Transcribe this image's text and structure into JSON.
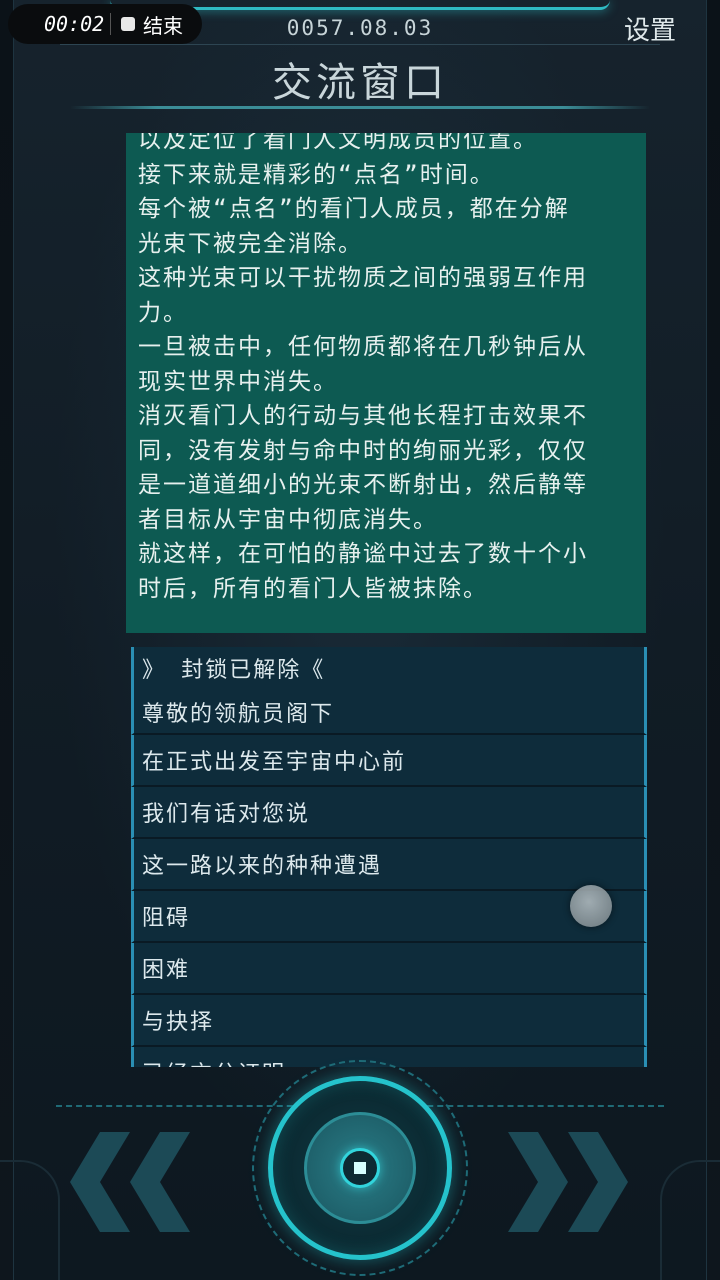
{
  "status_bar": {
    "record_time": "00:02",
    "record_end_label": "结束"
  },
  "header": {
    "date": "0057.08.03",
    "settings_label": "设置",
    "title": "交流窗口"
  },
  "story": {
    "lines": [
      "以及定位了看门人文明成员的位置。",
      "接下来就是精彩的“点名”时间。",
      "每个被“点名”的看门人成员，都在分解",
      "光束下被完全消除。",
      "这种光束可以干扰物质之间的强弱互作用",
      "力。",
      "一旦被击中，任何物质都将在几秒钟后从",
      "现实世界中消失。",
      "消灭看门人的行动与其他长程打击效果不",
      "同，没有发射与命中时的绚丽光彩，仅仅",
      "是一道道细小的光束不断射出，然后静等",
      "者目标从宇宙中彻底消失。",
      "就这样，在可怕的静谧中过去了数十个小",
      "时后，所有的看门人皆被抹除。"
    ]
  },
  "dialog": {
    "first": {
      "line1": "》 封锁已解除《",
      "line2": "尊敬的领航员阁下"
    },
    "items": [
      "在正式出发至宇宙中心前",
      "我们有话对您说",
      "这一路以来的种种遭遇",
      "阻碍",
      "困难",
      "与抉择",
      "已经充分证明"
    ]
  },
  "controls": {
    "prev_icon": "double-chevron-left-icon",
    "next_icon": "double-chevron-right-icon",
    "center_icon": "center-ring-button-icon"
  },
  "colors": {
    "accent": "#25c3cc",
    "story_bg": "#0d5a52",
    "dialog_bg": "#0e2c3b",
    "dialog_border": "#2a8fb4"
  }
}
